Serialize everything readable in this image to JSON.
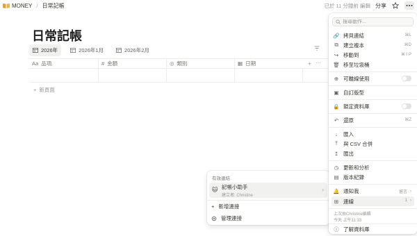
{
  "topbar": {
    "workspace": "MONEY",
    "separator": "/",
    "page": "日常記帳",
    "edited": "已於 11 分鐘前 編輯",
    "share": "分享"
  },
  "page": {
    "title": "日常記帳",
    "tabs": [
      {
        "label": "2026年",
        "active": true
      },
      {
        "label": "2026年1月",
        "active": false
      },
      {
        "label": "2026年2月",
        "active": false
      }
    ]
  },
  "table": {
    "columns": [
      {
        "icon": "Aa",
        "label": "品項"
      },
      {
        "icon": "#",
        "label": "金額"
      },
      {
        "icon": "◎",
        "label": "類別"
      },
      {
        "icon": "▦",
        "label": "日期"
      }
    ],
    "new_page": "新頁面"
  },
  "linked": {
    "header": "有效連結",
    "item_title": "記帳小助手",
    "item_sub": "建立者: Christine",
    "add_label": "新增連接",
    "manage_label": "管理連接"
  },
  "menu": {
    "search_placeholder": "搜尋動作...",
    "items": {
      "copy_link": "拷貝連結",
      "copy_link_kbd": "⌘L",
      "duplicate": "建立複本",
      "duplicate_kbd": "⌘D",
      "move_to": "移動到",
      "move_to_kbd": "⌘⇧P",
      "trash": "移至垃圾桶",
      "editable": "可離線使用",
      "customize": "自訂版型",
      "lock": "鎖定資料庫",
      "undo": "還原",
      "undo_kbd": "⌘Z",
      "import": "匯入",
      "merge_csv": "與 CSV 合併",
      "export": "匯出",
      "updates": "更新和分析",
      "history": "版本紀錄",
      "notify": "通知我",
      "notify_value": "留言",
      "connections": "連線",
      "connections_count": "1"
    },
    "meta_line1": "上次由Christine編輯",
    "meta_line2": "今天 上午11:33",
    "learn": "了解資料庫"
  },
  "colors": {
    "text": "#37352f",
    "muted": "#9b9a97",
    "hover": "#f1f1ef",
    "border": "#ededeb"
  }
}
